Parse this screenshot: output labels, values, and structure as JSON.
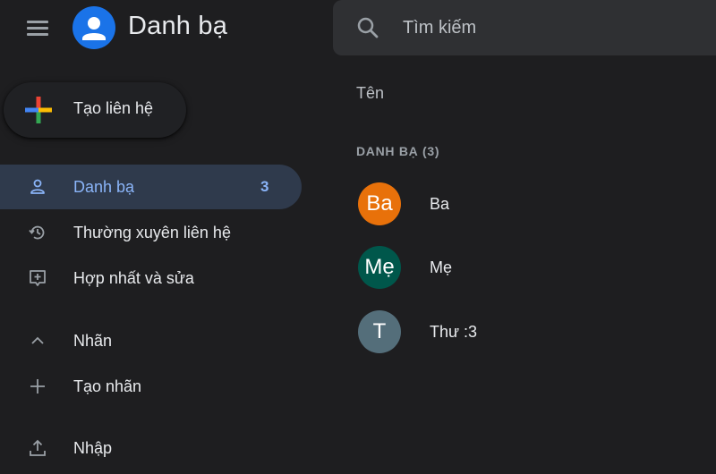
{
  "header": {
    "app_title": "Danh bạ",
    "menu_icon": "hamburger-menu-icon",
    "logo_icon": "contacts-person-icon"
  },
  "search": {
    "placeholder": "Tìm kiếm",
    "value": "",
    "icon": "search-icon"
  },
  "create_contact": {
    "label": "Tạo liên hệ",
    "icon": "multicolor-plus-icon"
  },
  "sidebar": {
    "items": [
      {
        "label": "Danh bạ",
        "count": "3",
        "icon": "person-outline-icon",
        "active": true
      },
      {
        "label": "Thường xuyên liên hệ",
        "icon": "history-icon",
        "active": false
      },
      {
        "label": "Hợp nhất và sửa",
        "icon": "merge-fix-icon",
        "active": false
      }
    ],
    "labels_section": {
      "label": "Nhãn",
      "icon": "chevron-up-icon"
    },
    "create_label": {
      "label": "Tạo nhãn",
      "icon": "plus-icon"
    },
    "import": {
      "label": "Nhập",
      "icon": "upload-icon"
    }
  },
  "main": {
    "column_header": "Tên",
    "group_header": "DANH BẠ (3)",
    "contacts": [
      {
        "initials": "Ba",
        "name": "Ba",
        "color": "#e8710a"
      },
      {
        "initials": "Mẹ",
        "name": "Mẹ",
        "color": "#00574b"
      },
      {
        "initials": "T",
        "name": "Thư :3",
        "color": "#546e7a"
      }
    ]
  },
  "colors": {
    "background": "#1e1e20",
    "accent": "#8ab4f8",
    "active_bg": "#2f3a4c",
    "logo_blue": "#1a73e8"
  }
}
